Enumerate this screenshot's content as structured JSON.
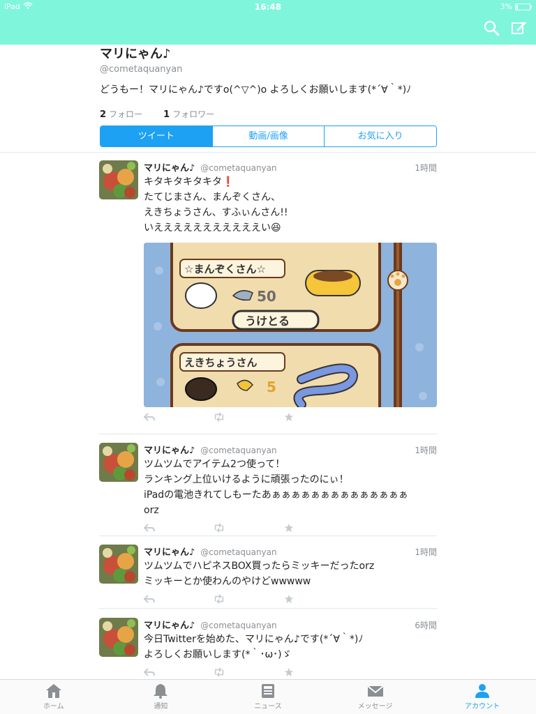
{
  "status_bar": {
    "device": "iPad",
    "time": "16:48",
    "battery": "3%"
  },
  "nav": {
    "search_icon": "search-icon",
    "compose_icon": "compose-icon"
  },
  "profile": {
    "name": "マリにゃん♪",
    "handle": "@cometaquanyan",
    "bio": "どうもー！マリにゃん♪ですo(^▽^)o よろしくお願いします(*´∀｀*)ﾉ",
    "following_count": "2",
    "following_label": "フォロー",
    "followers_count": "1",
    "followers_label": "フォロワー"
  },
  "segments": [
    {
      "label": "ツイート",
      "active": true
    },
    {
      "label": "動画/画像",
      "active": false
    },
    {
      "label": "お気に入り",
      "active": false
    }
  ],
  "tweets": [
    {
      "name": "マリにゃん♪",
      "handle": "@cometaquanyan",
      "time": "1時間",
      "text": "キタキタキタキタ❗️\nたてじまさん、まんぞくさん、\nえきちょうさん、すふぃんさん!!\nいえええええええええええい😆",
      "image": {
        "card1_title": "☆まんぞくさん☆",
        "card1_count": "50",
        "card1_button": "うけとる",
        "card2_title": "えきちょうさん",
        "card2_count": "5"
      }
    },
    {
      "name": "マリにゃん♪",
      "handle": "@cometaquanyan",
      "time": "1時間",
      "text": "ツムツムでアイテム2つ使って！\nランキング上位いけるように頑張ったのにぃ！\niPadの電池きれてしもーたあぁぁぁぁぁぁぁぁぁぁぁぁぁぁ\norz"
    },
    {
      "name": "マリにゃん♪",
      "handle": "@cometaquanyan",
      "time": "1時間",
      "text": "ツムツムでハピネスBOX買ったらミッキーだったorz\nミッキーとか使わんのやけどwwwww"
    },
    {
      "name": "マリにゃん♪",
      "handle": "@cometaquanyan",
      "time": "6時間",
      "text": "今日Twitterを始めた、マリにゃん♪です(*´∀｀*)ﾉ\nよろしくお願いします(*｀･ω･)ゞ"
    }
  ],
  "tabbar": [
    {
      "label": "ホーム",
      "icon": "home-icon",
      "active": false
    },
    {
      "label": "通知",
      "icon": "bell-icon",
      "active": false
    },
    {
      "label": "ニュース",
      "icon": "news-icon",
      "active": false
    },
    {
      "label": "メッセージ",
      "icon": "mail-icon",
      "active": false
    },
    {
      "label": "アカウント",
      "icon": "account-icon",
      "active": true
    }
  ],
  "colors": {
    "header": "#7ff5dc",
    "accent": "#1da1f2",
    "muted": "#8a8f94"
  }
}
